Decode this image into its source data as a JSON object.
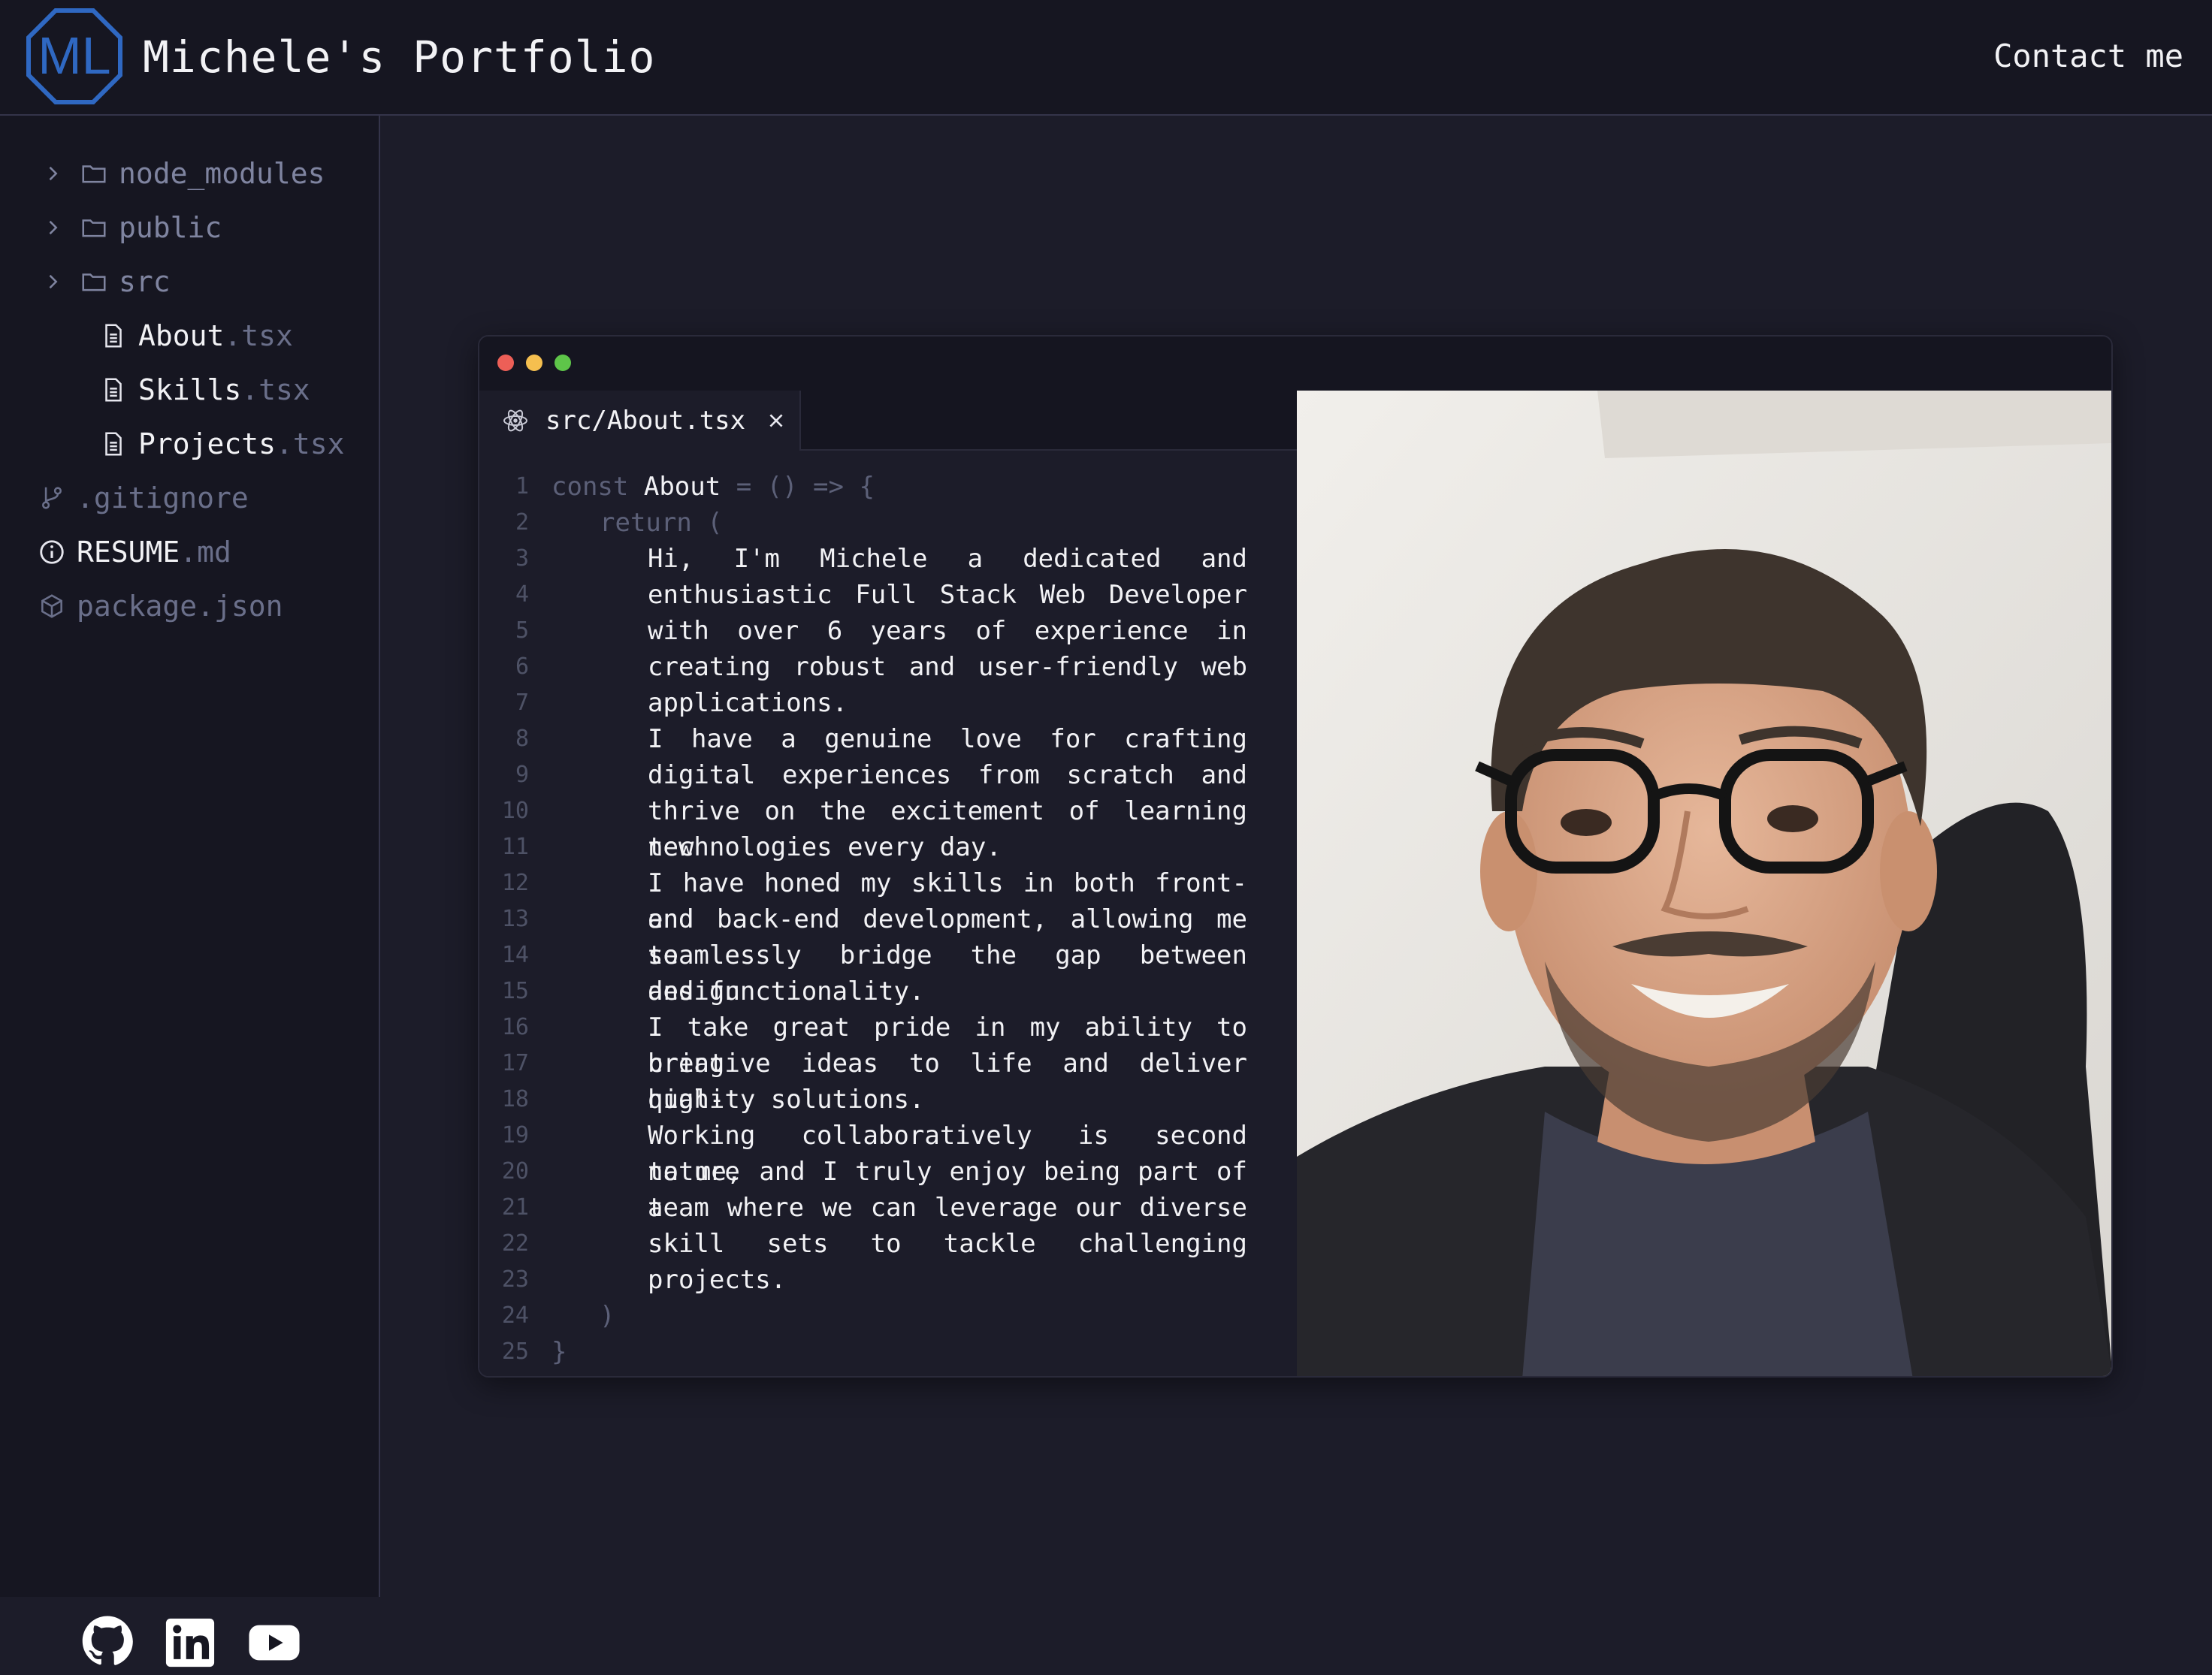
{
  "header": {
    "logo_text": "ML",
    "title": "Michele's Portfolio",
    "contact_label": "Contact me"
  },
  "sidebar": {
    "items": [
      {
        "kind": "folder",
        "name": "node_modules",
        "ext": ""
      },
      {
        "kind": "folder",
        "name": "public",
        "ext": ""
      },
      {
        "kind": "folder",
        "name": "src",
        "ext": ""
      },
      {
        "kind": "file",
        "name": "About",
        "ext": ".tsx"
      },
      {
        "kind": "file",
        "name": "Skills",
        "ext": ".tsx"
      },
      {
        "kind": "file",
        "name": "Projects",
        "ext": ".tsx"
      },
      {
        "kind": "git",
        "name": ".gitignore",
        "ext": ""
      },
      {
        "kind": "info",
        "name": "RESUME",
        "ext": ".md"
      },
      {
        "kind": "package",
        "name": "package.json",
        "ext": ""
      }
    ],
    "socials": [
      {
        "icon": "github-icon"
      },
      {
        "icon": "linkedin-icon"
      },
      {
        "icon": "youtube-icon"
      }
    ]
  },
  "editor": {
    "tab_label": "src/About.tsx",
    "window_dots": [
      "#ed5f57",
      "#f5bf4f",
      "#5ec549"
    ],
    "line_numbers": [
      "1",
      "2",
      "3",
      "4",
      "5",
      "6",
      "7",
      "8",
      "9",
      "10",
      "11",
      "12",
      "13",
      "14",
      "15",
      "16",
      "17",
      "18",
      "19",
      "20",
      "21",
      "22",
      "23",
      "24",
      "25"
    ],
    "code": {
      "l1_kw": "const",
      "l1_name": "About",
      "l1_rest": "= () => {",
      "l2": "return (",
      "body": [
        "Hi, I'm Michele a dedicated and",
        "enthusiastic Full Stack Web Developer",
        "with over 6 years of experience in",
        "creating robust and user-friendly web",
        "applications.",
        "I have a genuine love for crafting",
        "digital experiences from scratch and",
        "thrive on the excitement of learning new",
        "technologies every day.",
        "I have honed my skills in both front-end",
        "and back-end development, allowing me to",
        "seamlessly bridge the gap between design",
        "and functionality.",
        "I take great pride in my ability to bring",
        "creative ideas to life and deliver high-",
        "quality solutions.",
        "Working collaboratively is second nature",
        "to me, and I truly enjoy being part of a",
        "team where we can leverage our diverse",
        "skill sets to tackle challenging",
        "projects."
      ],
      "l24": ")",
      "l25": "}"
    }
  },
  "colors": {
    "background": "#1c1c29",
    "panel": "#161621",
    "accent_blue": "#2f68c2"
  }
}
